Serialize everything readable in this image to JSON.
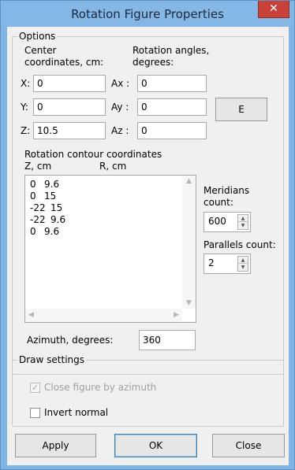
{
  "window": {
    "title": "Rotation Figure Properties",
    "close_glyph": "✕"
  },
  "options": {
    "group_label": "Options",
    "center_label_1": "Center",
    "center_label_2": "coordinates, cm:",
    "angles_label_1": "Rotation angles,",
    "angles_label_2": "degrees:",
    "x_label": "X:",
    "x_value": "0",
    "y_label": "Y:",
    "y_value": "0",
    "z_label": "Z:",
    "z_value": "10.5",
    "ax_label": "Ax :",
    "ax_value": "0",
    "ay_label": "Ay :",
    "ay_value": "0",
    "az_label": "Az :",
    "az_value": "0",
    "e_button": "E",
    "contour_label": "Rotation contour coordinates",
    "z_col": "Z, cm",
    "r_col": "R, cm",
    "contour_rows": [
      {
        "z": "0",
        "r": "9.6"
      },
      {
        "z": "0",
        "r": "15"
      },
      {
        "z": "-22",
        "r": "15"
      },
      {
        "z": "-22",
        "r": "9.6"
      },
      {
        "z": "0",
        "r": "9.6"
      }
    ],
    "meridians_label_1": "Meridians",
    "meridians_label_2": "count:",
    "meridians_value": "600",
    "parallels_label": "Parallels count:",
    "parallels_value": "2",
    "azimuth_label": "Azimuth, degrees:",
    "azimuth_value": "360"
  },
  "draw_settings": {
    "group_label": "Draw settings",
    "close_figure_label": "Close figure by azimuth",
    "close_figure_checked": true,
    "close_figure_enabled": false,
    "invert_normal_label": "Invert normal",
    "invert_normal_checked": false
  },
  "buttons": {
    "apply": "Apply",
    "ok": "OK",
    "close": "Close"
  },
  "colors": {
    "titlebar": "#84b6e6",
    "close": "#c9423a",
    "dialog_bg": "#f0f0f0"
  }
}
